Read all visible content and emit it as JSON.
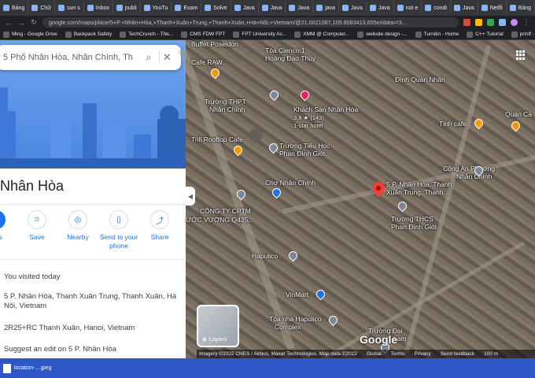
{
  "browser": {
    "tabs": [
      {
        "label": "Bảng"
      },
      {
        "label": "Chữ"
      },
      {
        "label": "sun s"
      },
      {
        "label": "Inbox"
      },
      {
        "label": "publi"
      },
      {
        "label": "YouTu"
      },
      {
        "label": "Exam"
      },
      {
        "label": "Solve"
      },
      {
        "label": "Java"
      },
      {
        "label": "Java"
      },
      {
        "label": "Java"
      },
      {
        "label": "java"
      },
      {
        "label": "Java"
      },
      {
        "label": "Java"
      },
      {
        "label": "not e"
      },
      {
        "label": "condi"
      },
      {
        "label": "Java"
      },
      {
        "label": "Netfli"
      },
      {
        "label": "Bảng"
      },
      {
        "label": "Kênh"
      },
      {
        "label": "Chữ"
      },
      {
        "label": "số 5"
      }
    ],
    "url": "google.com/maps/place/5+P.+Nhân+Hòa,+Thanh+Xuân+Trung,+Thanh+Xuân,+Hà+Nội,+Vietnam/@21.0021087,105.8083413,655m/data=!3...",
    "bookmarks": [
      {
        "label": "Ming - Google Drive"
      },
      {
        "label": "Backpack Safety"
      },
      {
        "label": "TechCrunch - The..."
      },
      {
        "label": "CMS FDW FPT"
      },
      {
        "label": "FPT University Ac..."
      },
      {
        "label": "XMM @ Computer..."
      },
      {
        "label": "website design -..."
      },
      {
        "label": "Turnitin - Home"
      },
      {
        "label": "C++ Tutorial"
      },
      {
        "label": "printf - C++ Refer..."
      }
    ]
  },
  "panel": {
    "search_value": "5 Phố Nhân Hòa, Nhân Chính, Th",
    "place_title": "Nhân Hòa",
    "actions": [
      {
        "label": "ions",
        "icon": "directions-icon"
      },
      {
        "label": "Save",
        "icon": "bookmark-icon"
      },
      {
        "label": "Nearby",
        "icon": "nearby-icon"
      },
      {
        "label": "Send to your phone",
        "icon": "phone-icon"
      },
      {
        "label": "Share",
        "icon": "share-icon"
      }
    ],
    "visited_text": "You visited today",
    "address": "5 P. Nhân Hòa, Thanh Xuân Trung, Thanh Xuân, Hà Nội, Vietnam",
    "plus_code": "2R25+RC Thanh Xuân, Hanoi, Vietnam",
    "suggest_edit": "Suggest an edit on 5 P. Nhân Hòa"
  },
  "map": {
    "labels": [
      {
        "text": "Buffet Poseidon"
      },
      {
        "text": "Cafe RAW"
      },
      {
        "text": "Tòa Cienco 1"
      },
      {
        "text": "Hoàng Đạo Thúy"
      },
      {
        "text": "Đình Quan Nhân"
      },
      {
        "text": "Trường THPT"
      },
      {
        "text": "Nhân Chính"
      },
      {
        "text": "Khách Sạn Nhân Hòa"
      },
      {
        "text": "3.8 ★ (143)"
      },
      {
        "text": "1-star hotel"
      },
      {
        "text": "Tịnh cafe"
      },
      {
        "text": "Quán Cà"
      },
      {
        "text": "Trill Rooftop Cafe"
      },
      {
        "text": "Trường Tiểu Học"
      },
      {
        "text": "Phan Đình Giót"
      },
      {
        "text": "Công An Phường"
      },
      {
        "text": "Nhân Chính"
      },
      {
        "text": "5 P. Nhân Hòa, Thanh"
      },
      {
        "text": "Xuân Trung, Thanh..."
      },
      {
        "text": "Chợ Nhân Chính"
      },
      {
        "text": "CÔNG TY CPTM"
      },
      {
        "text": "ƯỚC VƯƠNG Q435..."
      },
      {
        "text": "Trường THCS"
      },
      {
        "text": "Phan Đình Giót"
      },
      {
        "text": "Hapulico"
      },
      {
        "text": "VinMart"
      },
      {
        "text": "Tòa nhà Hapulico"
      },
      {
        "text": "Complex"
      },
      {
        "text": "Trường Đại"
      },
      {
        "text": "Lam"
      }
    ],
    "layers_label": "Layers",
    "google_logo": "Google",
    "attribution": [
      "Imagery ©2022 CNES / Airbus, Maxar Technologies, Map data ©2022",
      "Global",
      "Terms",
      "Privacy",
      "Send feedback",
      "100 m"
    ]
  },
  "downloads": {
    "file": "location-....jpeg"
  },
  "colors": {
    "accent": "#1a73e8",
    "pin": "#ea4335"
  }
}
